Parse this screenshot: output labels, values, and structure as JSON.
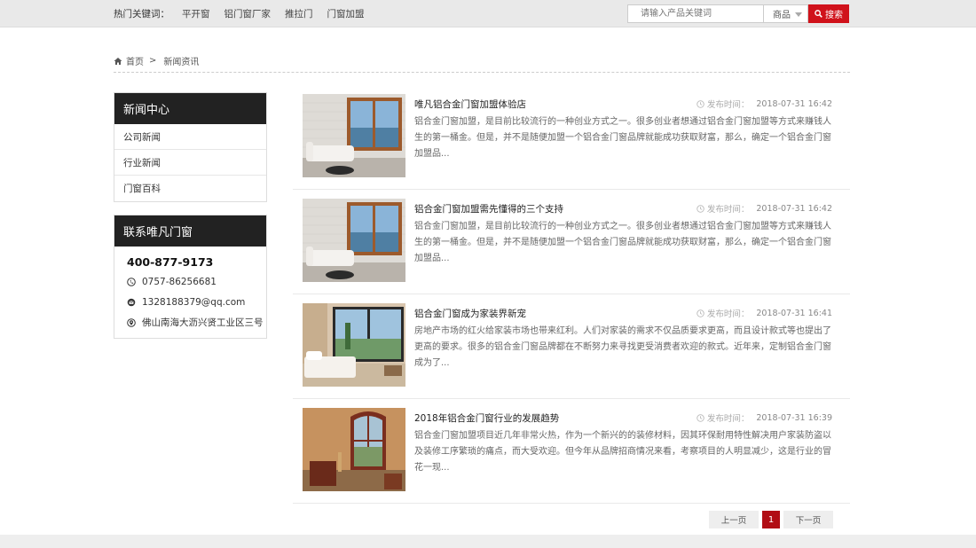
{
  "topbar": {
    "hot_label": "热门关键词：",
    "keywords": [
      "平开窗",
      "铝门窗厂家",
      "推拉门",
      "门窗加盟"
    ],
    "search_placeholder": "请输入产品关键词",
    "search_scope": "商品",
    "search_button": "搜索"
  },
  "breadcrumb": {
    "home": "首页",
    "separator": ">",
    "current": "新闻资讯"
  },
  "sidebar": {
    "news_center": {
      "title": "新闻中心",
      "items": [
        "公司新闻",
        "行业新闻",
        "门窗百科"
      ]
    },
    "contact": {
      "title": "联系唯凡门窗",
      "hotline": "400-877-9173",
      "phone": "0757-86256681",
      "email": "1328188379@qq.com",
      "address": "佛山南海大沥兴贤工业区三号"
    }
  },
  "news": {
    "date_label": "发布时间：",
    "items": [
      {
        "title": "唯凡铝合金门窗加盟体验店",
        "date": "2018-07-31 16:42",
        "desc": "铝合金门窗加盟，是目前比较流行的一种创业方式之一。很多创业者想通过铝合金门窗加盟等方式来赚钱人生的第一桶金。但是，并不是随便加盟一个铝合金门窗品牌就能成功获取财富，那么，确定一个铝合金门窗加盟品..."
      },
      {
        "title": "铝合金门窗加盟需先懂得的三个支持",
        "date": "2018-07-31 16:42",
        "desc": "铝合金门窗加盟，是目前比较流行的一种创业方式之一。很多创业者想通过铝合金门窗加盟等方式来赚钱人生的第一桶金。但是，并不是随便加盟一个铝合金门窗品牌就能成功获取财富，那么，确定一个铝合金门窗加盟品..."
      },
      {
        "title": "铝合金门窗成为家装界新宠",
        "date": "2018-07-31 16:41",
        "desc": "房地产市场的红火给家装市场也带来红利。人们对家装的需求不仅品质要求更高，而且设计款式等也提出了更高的要求。很多的铝合金门窗品牌都在不断努力来寻找更受消费者欢迎的款式。近年来，定制铝合金门窗成为了..."
      },
      {
        "title": "2018年铝合金门窗行业的发展趋势",
        "date": "2018-07-31 16:39",
        "desc": "铝合金门窗加盟项目近几年非常火热，作为一个新兴的的装修材料，因其环保耐用特性解决用户家装防盗以及装修工序繁琐的痛点，而大受欢迎。但今年从品牌招商情况来看，考察项目的人明显减少，这是行业的冒花一现..."
      }
    ]
  },
  "pagination": {
    "prev": "上一页",
    "current": "1",
    "next": "下一页"
  },
  "colors": {
    "accent": "#d0121b",
    "page_active": "#b10d14",
    "sidebar_header": "#222222"
  }
}
